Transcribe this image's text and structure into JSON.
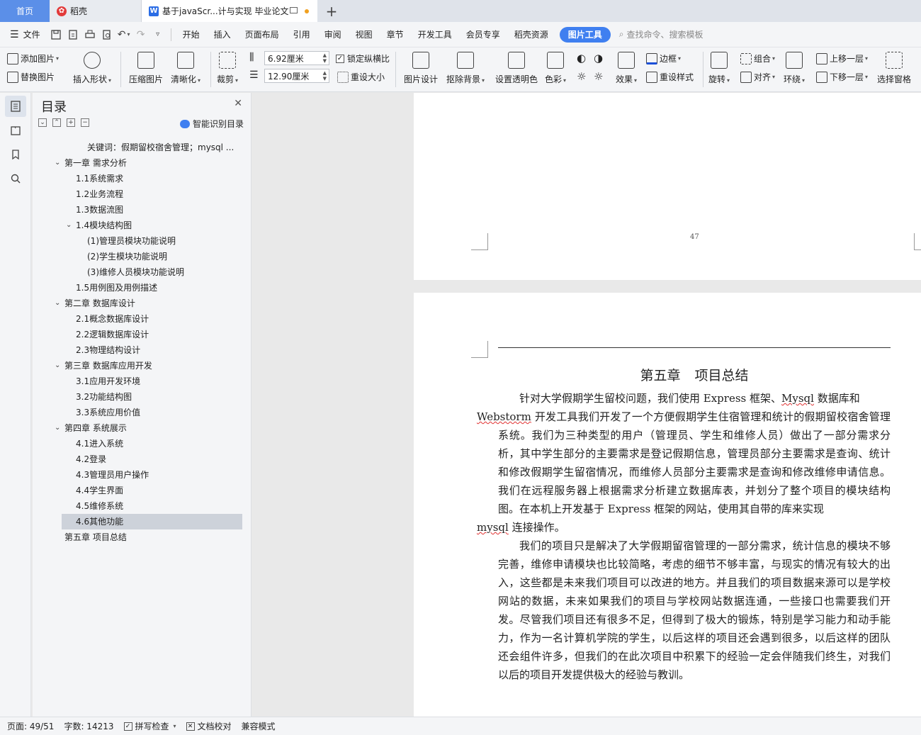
{
  "tabs": {
    "home": "首页",
    "daoke": "稻壳",
    "doc": "基于javaScr...计与实现 毕业论文"
  },
  "menubar": {
    "file": "文件",
    "items": [
      "开始",
      "插入",
      "页面布局",
      "引用",
      "审阅",
      "视图",
      "章节",
      "开发工具",
      "会员专享",
      "稻壳资源"
    ],
    "active_tool": "图片工具",
    "search_placeholder": "查找命令、搜索模板"
  },
  "ribbon": {
    "add_image": "添加图片",
    "replace_image": "替换图片",
    "insert_shape": "插入形状",
    "compress_image": "压缩图片",
    "sharpen": "清晰化",
    "crop": "裁剪",
    "width": "6.92厘米",
    "height": "12.90厘米",
    "lock_ratio": "锁定纵横比",
    "reset_size": "重设大小",
    "image_design": "图片设计",
    "remove_bg": "抠除背景",
    "set_transparent": "设置透明色",
    "color": "色彩",
    "effects": "效果",
    "border": "边框",
    "reset_style": "重设样式",
    "rotate": "旋转",
    "group": "组合",
    "align": "对齐",
    "wrap": "环绕",
    "bring_forward": "上移一层",
    "send_backward": "下移一层",
    "selection_pane": "选择窗格"
  },
  "toc": {
    "title": "目录",
    "smart": "智能识别目录",
    "items": [
      {
        "text": "关键词：假期留校宿舍管理；mysql ...",
        "level": 2,
        "toggle": false
      },
      {
        "text": "第一章  需求分析",
        "level": 0,
        "toggle": true
      },
      {
        "text": "1.1系统需求",
        "level": 1,
        "toggle": false
      },
      {
        "text": "1.2业务流程",
        "level": 1,
        "toggle": false
      },
      {
        "text": "1.3数据流图",
        "level": 1,
        "toggle": false
      },
      {
        "text": "1.4模块结构图",
        "level": 1,
        "toggle": true
      },
      {
        "text": "(1)管理员模块功能说明",
        "level": 2,
        "toggle": false
      },
      {
        "text": "(2)学生模块功能说明",
        "level": 2,
        "toggle": false
      },
      {
        "text": "(3)维修人员模块功能说明",
        "level": 2,
        "toggle": false
      },
      {
        "text": "1.5用例图及用例描述",
        "level": 1,
        "toggle": false
      },
      {
        "text": "第二章  数据库设计",
        "level": 0,
        "toggle": true
      },
      {
        "text": "2.1概念数据库设计",
        "level": 1,
        "toggle": false
      },
      {
        "text": "2.2逻辑数据库设计",
        "level": 1,
        "toggle": false
      },
      {
        "text": "2.3物理结构设计",
        "level": 1,
        "toggle": false
      },
      {
        "text": "第三章  数据库应用开发",
        "level": 0,
        "toggle": true
      },
      {
        "text": "3.1应用开发环境",
        "level": 1,
        "toggle": false
      },
      {
        "text": "3.2功能结构图",
        "level": 1,
        "toggle": false
      },
      {
        "text": "3.3系统应用价值",
        "level": 1,
        "toggle": false
      },
      {
        "text": "第四章  系统展示",
        "level": 0,
        "toggle": true
      },
      {
        "text": "4.1进入系统",
        "level": 1,
        "toggle": false
      },
      {
        "text": "4.2登录",
        "level": 1,
        "toggle": false
      },
      {
        "text": "4.3管理员用户操作",
        "level": 1,
        "toggle": false
      },
      {
        "text": "4.4学生界面",
        "level": 1,
        "toggle": false
      },
      {
        "text": "4.5维修系统",
        "level": 1,
        "toggle": false
      },
      {
        "text": "4.6其他功能",
        "level": 1,
        "toggle": false,
        "selected": true
      },
      {
        "text": "第五章  项目总结",
        "level": 0,
        "toggle": false
      }
    ]
  },
  "document": {
    "page_number": "47",
    "chapter_no": "第五章",
    "chapter_title": "项目总结",
    "p1_a": "针对大学假期学生留校问题，我们使用 Express 框架、",
    "p1_mysql": "Mysql",
    "p1_b": " 数据库和",
    "p1_webstorm": "Webstorm",
    "p1_c": " 开发工具我们开发了一个方便假期学生住宿管理和统计的假期留校宿舍管理系统。我们为三种类型的用户（管理员、学生和维修人员）做出了一部分需求分析，其中学生部分的主要需求是登记假期信息，管理员部分主要需求是查询、统计和修改假期学生留宿情况，而维修人员部分主要需求是查询和修改维修申请信息。我们在远程服务器上根据需求分析建立数据库表，并划分了整个项目的模块结构图。在本机上开发基于 Express 框架的网站，使用其自带的库来实现",
    "p1_mysql2": "mysql",
    "p1_d": " 连接操作。",
    "p2": "我们的项目只是解决了大学假期留宿管理的一部分需求，统计信息的模块不够完善，维修申请模块也比较简略，考虑的细节不够丰富，与现实的情况有较大的出入，这些都是未来我们项目可以改进的地方。并且我们的项目数据来源可以是学校网站的数据，未来如果我们的项目与学校网站数据连通，一些接口也需要我们开发。尽管我们项目还有很多不足，但得到了极大的锻炼，特别是学习能力和动手能力，作为一名计算机学院的学生，以后这样的项目还会遇到很多，以后这样的团队还会组件许多，但我们的在此次项目中积累下的经验一定会伴随我们终生，对我们以后的项目开发提供极大的经验与教训。"
  },
  "status": {
    "page": "页面: 49/51",
    "words": "字数: 14213",
    "spell": "拼写检查",
    "proof": "文档校对",
    "compat": "兼容模式"
  },
  "colors": {
    "accent": "#3f7ff0",
    "home_tab": "#5b8fe8",
    "daoke_red": "#e23a3a",
    "wps_blue": "#2b6de5"
  }
}
